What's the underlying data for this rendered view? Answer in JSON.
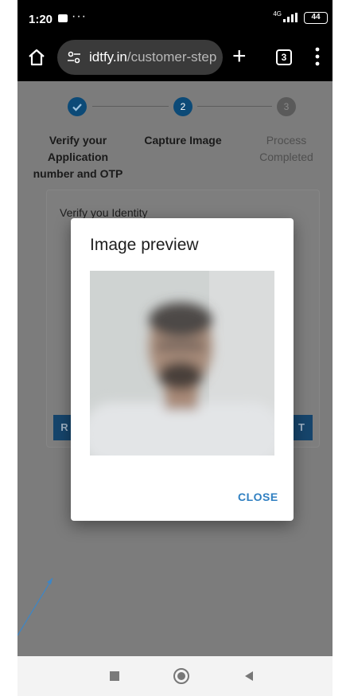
{
  "status_bar": {
    "time": "1:20",
    "dots": "···",
    "network": "4G",
    "battery": "44"
  },
  "browser": {
    "url_host": "idtfy.in",
    "url_path": "/customer-step",
    "tab_count": "3",
    "new_tab_label": "+"
  },
  "stepper": {
    "steps": [
      {
        "number": "1",
        "label": "Verify your Application number and OTP",
        "state": "completed"
      },
      {
        "number": "2",
        "label": "Capture Image",
        "state": "active"
      },
      {
        "number": "3",
        "label": "Process Completed",
        "state": "pending"
      }
    ]
  },
  "card": {
    "title": "Verify you Identity",
    "left_button_label": "R",
    "right_button_label": "T"
  },
  "modal": {
    "title": "Image preview",
    "close_label": "CLOSE"
  },
  "colors": {
    "accent": "#2f7fc1",
    "step_active": "#0c4a77",
    "overlay_bg": "#7c7c7c"
  }
}
